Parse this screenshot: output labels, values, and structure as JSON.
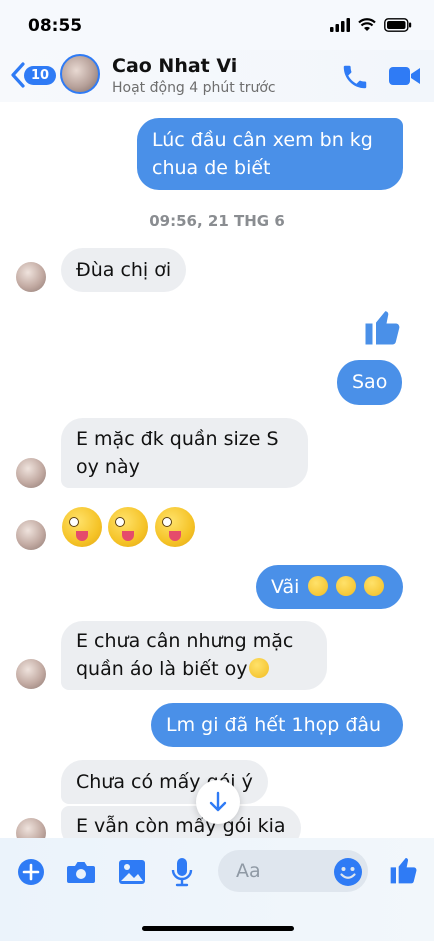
{
  "status_bar": {
    "time": "08:55"
  },
  "header": {
    "back_badge": "10",
    "contact_name": "Cao Nhat Vi",
    "contact_status": "Hoạt động 4 phút trước"
  },
  "timestamp": "09:56, 21 THG 6",
  "messages": {
    "m1": "Lúc đầu cân xem bn kg",
    "m1b": "chua de biết",
    "m2": "Đùa chị ơi",
    "m3": "Sao",
    "m4": "E mặc đk quần size S",
    "m4b": "oy này",
    "m5": "Vãi",
    "m6": "E chưa cân nhưng mặc",
    "m6b": "quần áo là biết oy",
    "m7": "Lm gi đã hết 1họp đâu",
    "m8": "Chưa có mấy gói ý",
    "m9": "E vẫn còn mấy gói kia"
  },
  "composer": {
    "placeholder": "Aa"
  },
  "colors": {
    "accent": "#2f7bf5",
    "outgoing": "#4a90e8",
    "incoming": "#eceef1"
  }
}
